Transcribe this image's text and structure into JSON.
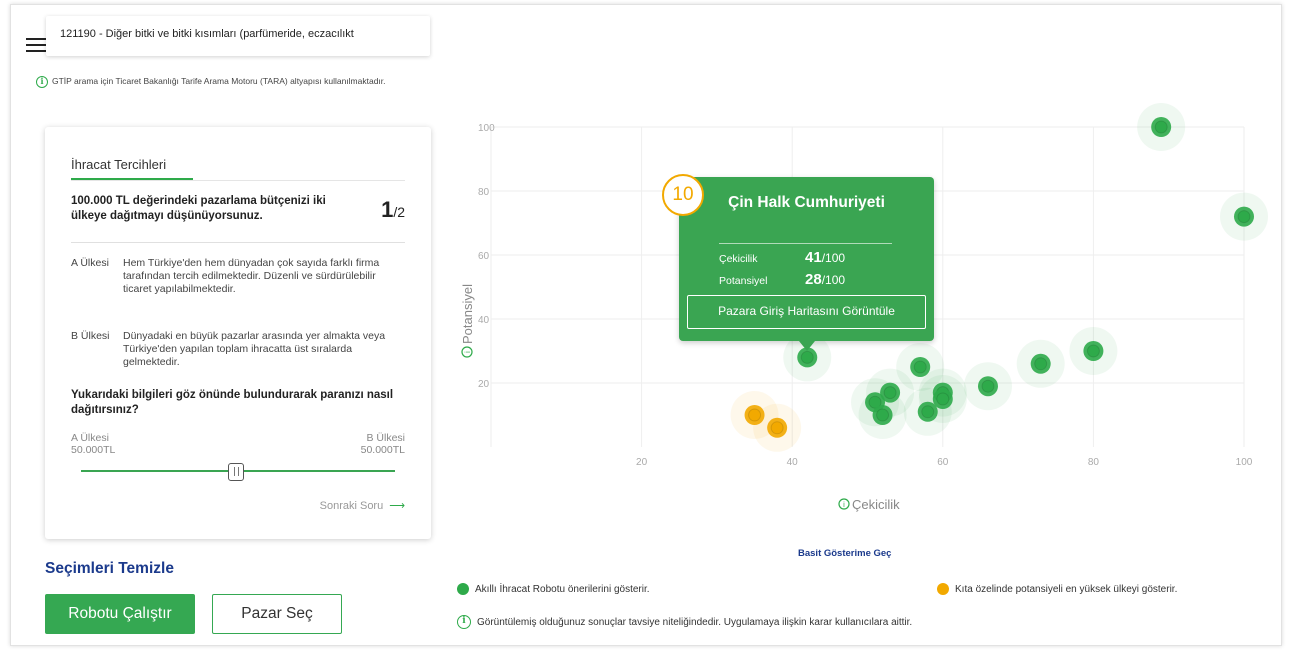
{
  "header": {
    "search_value": "121190 - Diğer bitki ve bitki kısımları (parfümeride, eczacılıkt",
    "info_note": "GTİP arama için Ticaret Bakanlığı Tarife Arama Motoru (TARA) altyapısı kullanılmaktadır."
  },
  "card": {
    "title": "İhracat Tercihleri",
    "question": "100.000 TL değerindeki pazarlama bütçenizi iki ülkeye dağıtmayı düşünüyorsunuz.",
    "counter_current": "1",
    "counter_total": "/2",
    "options": [
      {
        "label": "A Ülkesi",
        "text": "Hem Türkiye'den hem dünyadan çok sayıda farklı firma tarafından tercih edilmektedir. Düzenli ve sürdürülebilir ticaret yapılabilmektedir."
      },
      {
        "label": "B Ülkesi",
        "text": "Dünyadaki en büyük pazarlar arasında yer almakta veya Türkiye'den yapılan toplam ihracatta üst sıralarda gelmektedir."
      }
    ],
    "question2": "Yukarıdaki bilgileri göz önünde bulundurarak paranızı nasıl dağıtırsınız?",
    "slider": {
      "a_label": "A Ülkesi",
      "a_value": "50.000TL",
      "b_label": "B Ülkesi",
      "b_value": "50.000TL",
      "position": 0.5
    },
    "next_label": "Sonraki Soru",
    "next_arrow": "⟶"
  },
  "actions": {
    "clear": "Seçimleri Temizle",
    "run": "Robotu Çalıştır",
    "select": "Pazar Seç"
  },
  "tooltip": {
    "badge": "10",
    "title": "Çin Halk Cumhuriyeti",
    "attractiveness_label": "Çekicilik",
    "attractiveness_value": "41",
    "potential_label": "Potansiyel",
    "potential_value": "28",
    "denominator": "/100",
    "button": "Pazara Giriş Haritasını Görüntüle"
  },
  "chart_data": {
    "type": "scatter",
    "xlabel": "Çekicilik",
    "ylabel": "Potansiyel",
    "xlim": [
      0,
      100
    ],
    "ylim": [
      0,
      100
    ],
    "xticks": [
      20,
      40,
      60,
      80,
      100
    ],
    "yticks": [
      20,
      40,
      60,
      80,
      100
    ],
    "grid": true,
    "series": [
      {
        "color": "#2eaa4a",
        "points": [
          {
            "x": 89,
            "y": 100
          },
          {
            "x": 100,
            "y": 72
          },
          {
            "x": 80,
            "y": 30
          },
          {
            "x": 73,
            "y": 26
          },
          {
            "x": 66,
            "y": 19
          },
          {
            "x": 57,
            "y": 25
          },
          {
            "x": 60,
            "y": 17
          },
          {
            "x": 60,
            "y": 15
          },
          {
            "x": 58,
            "y": 11
          },
          {
            "x": 53,
            "y": 17
          },
          {
            "x": 51,
            "y": 14
          },
          {
            "x": 52,
            "y": 10
          },
          {
            "x": 42,
            "y": 28
          }
        ]
      },
      {
        "color": "#f2a900",
        "points": [
          {
            "x": 35,
            "y": 10
          },
          {
            "x": 38,
            "y": 6
          }
        ]
      }
    ]
  },
  "footer": {
    "simple_view": "Basit Gösterime Geç",
    "legend_green": "Akıllı İhracat Robotu önerilerini gösterir.",
    "legend_orange": "Kıta özelinde potansiyeli en yüksek ülkeyi gösterir.",
    "disclaimer": "Görüntülemiş olduğunuz sonuçlar tavsiye niteliğindedir. Uygulamaya ilişkin karar kullanıcılara aittir."
  },
  "colors": {
    "accent_green": "#2eaa4a",
    "orange": "#f2a900",
    "navy": "#1b3a8c"
  }
}
